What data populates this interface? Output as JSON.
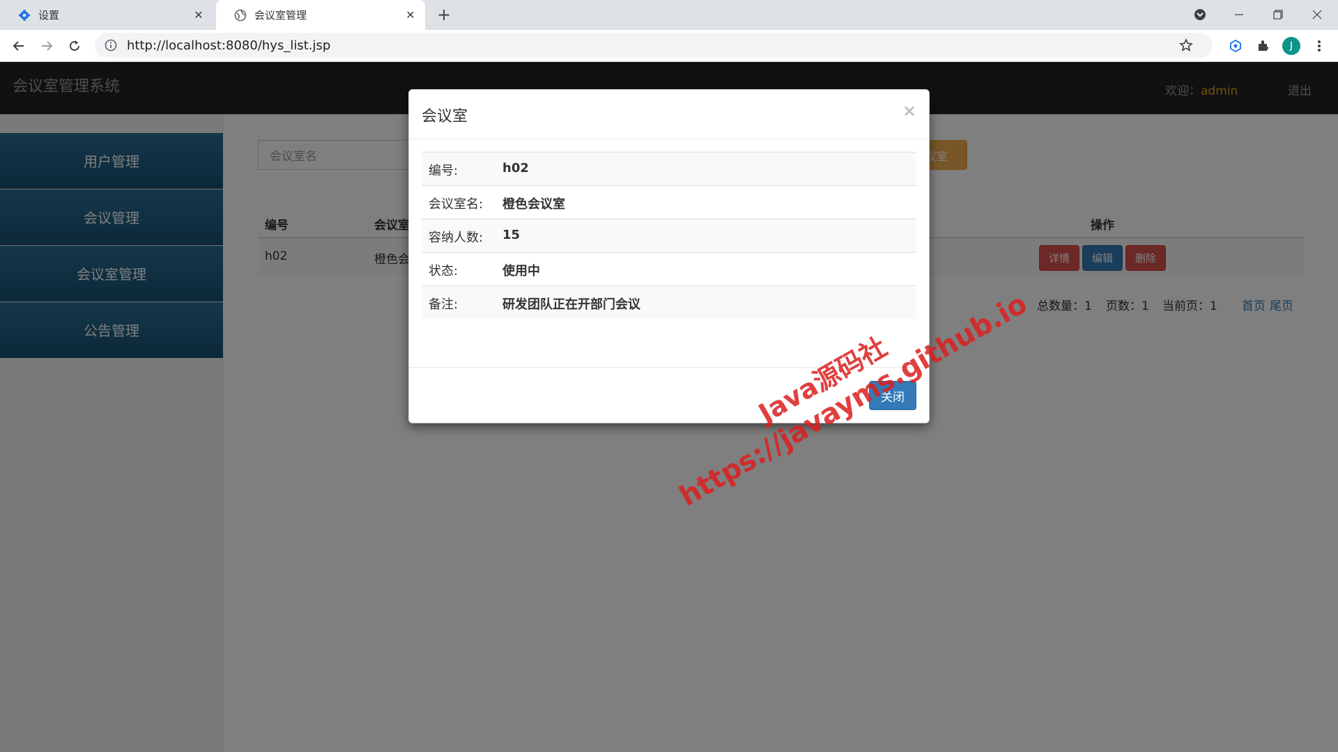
{
  "browser": {
    "tabs": [
      {
        "title": "设置"
      },
      {
        "title": "会议室管理"
      }
    ],
    "url": "http://localhost:8080/hys_list.jsp",
    "profile_initial": "J"
  },
  "app": {
    "brand": "会议室管理系统",
    "welcome_label": "欢迎：",
    "username": "admin",
    "logout": "退出"
  },
  "sidebar": {
    "items": [
      {
        "label": "用户管理"
      },
      {
        "label": "会议管理"
      },
      {
        "label": "会议室管理"
      },
      {
        "label": "公告管理"
      }
    ]
  },
  "toolbar": {
    "search_placeholder": "会议室名",
    "add_button": "议室"
  },
  "table": {
    "headers": {
      "id": "编号",
      "name": "会议室",
      "actions": "操作"
    },
    "rows": [
      {
        "id": "h02",
        "name": "橙色会",
        "detail": "详情",
        "edit": "编辑",
        "delete": "删除"
      }
    ]
  },
  "pagination": {
    "total": "总数量：1",
    "pages": "页数：1",
    "current": "当前页：1",
    "first": "首页",
    "last": "尾页"
  },
  "modal": {
    "title": "会议室",
    "close_x": "×",
    "fields": [
      {
        "label": "编号:",
        "value": "h02"
      },
      {
        "label": "会议室名:",
        "value": "橙色会议室"
      },
      {
        "label": "容纳人数:",
        "value": "15"
      },
      {
        "label": "状态:",
        "value": "使用中"
      },
      {
        "label": "备注:",
        "value": "研发团队正在开部门会议"
      }
    ],
    "close_button": "关闭"
  },
  "watermark": {
    "line1": "Java源码社",
    "line2": "https://javayms.github.io"
  },
  "colors": {
    "header_bg": "#222222",
    "sidebar_item": "#1f5f85",
    "primary": "#337ab7",
    "danger": "#d9534f",
    "warning": "#f0ad4e",
    "username": "#e8a316",
    "watermark": "#dc1e1e"
  }
}
